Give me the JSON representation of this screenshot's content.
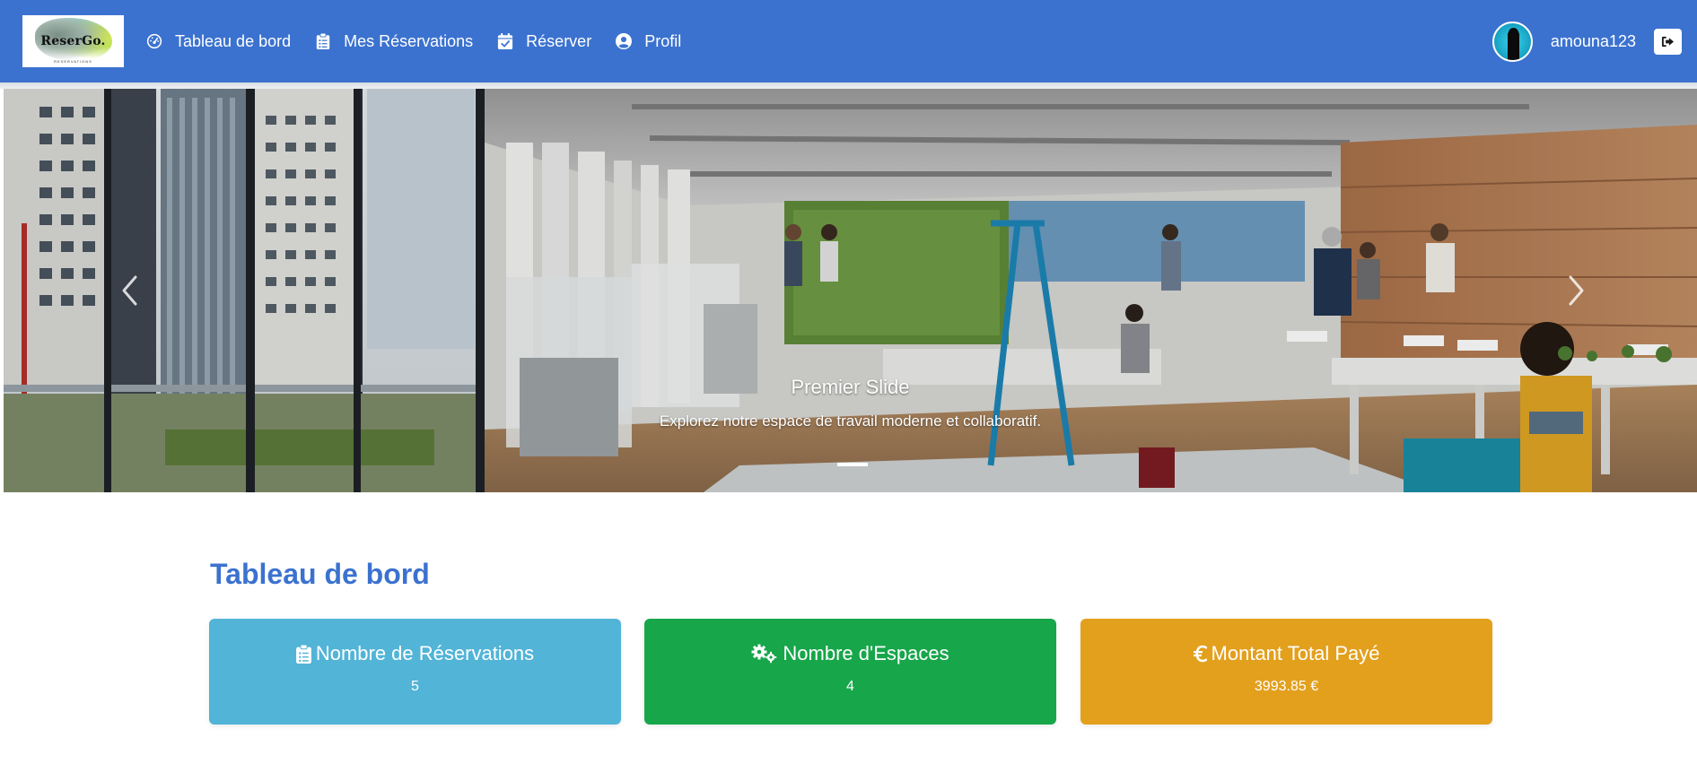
{
  "app": {
    "logo_text": "ReserGo.",
    "logo_subtext": "RESERVATIONS"
  },
  "nav": {
    "items": [
      {
        "label": "Tableau de bord",
        "icon": "dashboard-gauge-icon"
      },
      {
        "label": "Mes Réservations",
        "icon": "clipboard-list-icon"
      },
      {
        "label": "Réserver",
        "icon": "calendar-check-icon"
      },
      {
        "label": "Profil",
        "icon": "user-circle-icon"
      }
    ]
  },
  "user": {
    "username": "amouna123",
    "logout_icon": "sign-out-icon"
  },
  "carousel": {
    "slide_title": "Premier Slide",
    "slide_text": "Explorez notre espace de travail moderne et collaboratif.",
    "prev_icon": "chevron-left-icon",
    "next_icon": "chevron-right-icon",
    "slide_count": 1
  },
  "dashboard": {
    "title": "Tableau de bord",
    "cards": [
      {
        "title": "Nombre de Réservations",
        "value": "5",
        "icon": "clipboard-list-icon",
        "color": "#52b4d7"
      },
      {
        "title": "Nombre d'Espaces",
        "value": "4",
        "icon": "cogs-icon",
        "color": "#17a64a"
      },
      {
        "title": "Montant Total Payé",
        "value": "3993.85 €",
        "icon": "euro-sign-icon",
        "color": "#e3a01d"
      }
    ]
  },
  "colors": {
    "primary": "#3b72cf",
    "navbar_text": "#ffffff"
  }
}
